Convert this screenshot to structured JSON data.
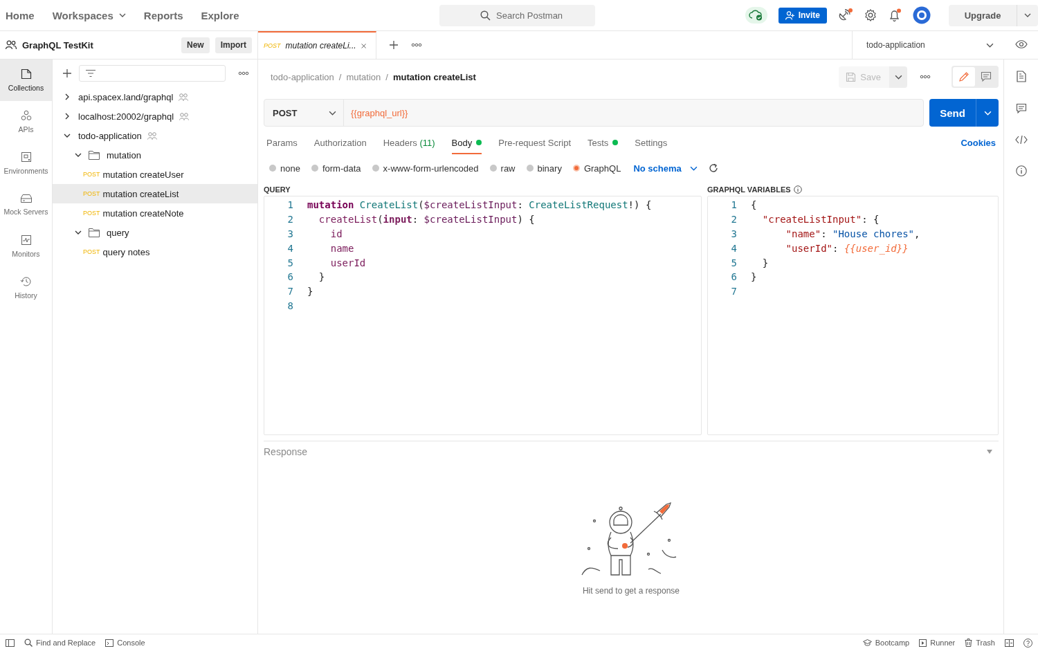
{
  "top_nav": {
    "items": [
      {
        "label": "Home",
        "dropdown": false
      },
      {
        "label": "Workspaces",
        "dropdown": true
      },
      {
        "label": "Reports",
        "dropdown": false
      },
      {
        "label": "Explore",
        "dropdown": false
      }
    ],
    "search": {
      "placeholder": "Search Postman"
    },
    "invite": "Invite",
    "upgrade": "Upgrade"
  },
  "workspace": {
    "name": "GraphQL TestKit",
    "buttons": [
      "New",
      "Import"
    ]
  },
  "left_rail": [
    {
      "label": "Collections",
      "kind": "collections",
      "selected": true
    },
    {
      "label": "APIs",
      "kind": "apis",
      "selected": false
    },
    {
      "label": "Environments",
      "kind": "environments",
      "selected": false
    },
    {
      "label": "Mock Servers",
      "kind": "mock",
      "selected": false
    },
    {
      "label": "Monitors",
      "kind": "monitors",
      "selected": false
    },
    {
      "label": "History",
      "kind": "history",
      "selected": false
    }
  ],
  "tree": [
    {
      "kind": "collection",
      "name": "api.spacex.land/graphql",
      "expanded": false
    },
    {
      "kind": "collection",
      "name": "localhost:20002/graphql",
      "expanded": false
    },
    {
      "kind": "collection",
      "name": "todo-application",
      "expanded": true,
      "children": [
        {
          "kind": "folder",
          "name": "mutation",
          "expanded": true,
          "children": [
            {
              "kind": "request",
              "method": "POST",
              "name": "mutation createUser",
              "selected": false
            },
            {
              "kind": "request",
              "method": "POST",
              "name": "mutation createList",
              "selected": true
            },
            {
              "kind": "request",
              "method": "POST",
              "name": "mutation createNote",
              "selected": false
            }
          ]
        },
        {
          "kind": "folder",
          "name": "query",
          "expanded": true,
          "children": [
            {
              "kind": "request",
              "method": "POST",
              "name": "query notes",
              "selected": false
            }
          ]
        }
      ]
    }
  ],
  "tabs": [
    {
      "method": "POST",
      "title": "mutation createLi...",
      "selected": true
    }
  ],
  "environment": "todo-application",
  "breadcrumb": [
    {
      "label": "todo-application"
    },
    {
      "separator": "/",
      "label": "mutation"
    },
    {
      "separator": "/",
      "label": "mutation createList"
    }
  ],
  "save": "Save",
  "request": {
    "method": "POST",
    "url": "{{graphql_url}}",
    "send": "Send"
  },
  "request_tabs": [
    {
      "label": "Params",
      "dot": false,
      "selected": false
    },
    {
      "label": "Authorization",
      "dot": false,
      "selected": false
    },
    {
      "label": "Headers",
      "count": "(11)",
      "dot": false,
      "selected": false
    },
    {
      "label": "Body",
      "dot": true,
      "selected": true
    },
    {
      "label": "Pre-request Script",
      "dot": false,
      "selected": false
    },
    {
      "label": "Tests",
      "dot": true,
      "selected": false
    },
    {
      "label": "Settings",
      "dot": false,
      "selected": false
    }
  ],
  "cookies": "Cookies",
  "body_types": [
    {
      "label": "none",
      "selected": false
    },
    {
      "label": "form-data",
      "selected": false
    },
    {
      "label": "x-www-form-urlencoded",
      "selected": false
    },
    {
      "label": "raw",
      "selected": false
    },
    {
      "label": "binary",
      "selected": false
    },
    {
      "label": "GraphQL",
      "selected": true
    }
  ],
  "schema": "No schema",
  "query": {
    "title": "QUERY",
    "lines": [
      {
        "n": "1",
        "tokens": [
          {
            "text": "mutation",
            "kind": "keyword"
          },
          {
            "text": " CreateList",
            "kind": "def"
          },
          {
            "text": "(",
            "kind": "punct"
          },
          {
            "text": "$createListInput",
            "kind": "variable"
          },
          {
            "text": ": ",
            "kind": "punct"
          },
          {
            "text": "CreateListRequest",
            "kind": "def"
          },
          {
            "text": "!) {",
            "kind": "punct"
          }
        ]
      },
      {
        "n": "2",
        "tokens": [
          {
            "text": "  createList",
            "kind": "property"
          },
          {
            "text": "(",
            "kind": "punct"
          },
          {
            "text": "input",
            "kind": "attr"
          },
          {
            "text": ": ",
            "kind": "punct"
          },
          {
            "text": "$createListInput",
            "kind": "variable"
          },
          {
            "text": ") {",
            "kind": "punct"
          }
        ]
      },
      {
        "n": "3",
        "tokens": [
          {
            "text": "    id",
            "kind": "property"
          }
        ]
      },
      {
        "n": "4",
        "tokens": [
          {
            "text": "    name",
            "kind": "property"
          }
        ]
      },
      {
        "n": "5",
        "tokens": [
          {
            "text": "    userId",
            "kind": "property"
          }
        ]
      },
      {
        "n": "6",
        "tokens": [
          {
            "text": "  }",
            "kind": "punct"
          }
        ]
      },
      {
        "n": "7",
        "tokens": [
          {
            "text": "}",
            "kind": "punct"
          }
        ]
      },
      {
        "n": "8"
      }
    ]
  },
  "variables": {
    "title": "GRAPHQL VARIABLES",
    "lines": [
      {
        "n": "1",
        "tokens": [
          {
            "text": "{",
            "kind": "punct"
          }
        ]
      },
      {
        "n": "2",
        "tokens": [
          {
            "text": "  \"createListInput\"",
            "kind": "key"
          },
          {
            "text": ": {",
            "kind": "punct"
          }
        ]
      },
      {
        "n": "3",
        "tokens": [
          {
            "text": "      \"name\"",
            "kind": "key"
          },
          {
            "text": ": ",
            "kind": "punct"
          },
          {
            "text": "\"House chores\"",
            "kind": "string"
          },
          {
            "text": ",",
            "kind": "punct"
          }
        ]
      },
      {
        "n": "4",
        "tokens": [
          {
            "text": "      \"userId\"",
            "kind": "key"
          },
          {
            "text": ": ",
            "kind": "punct"
          },
          {
            "text": "{{user_id}}",
            "kind": "template"
          }
        ]
      },
      {
        "n": "5",
        "tokens": [
          {
            "text": "  }",
            "kind": "punct"
          }
        ]
      },
      {
        "n": "6",
        "tokens": [
          {
            "text": "}",
            "kind": "punct"
          }
        ]
      },
      {
        "n": "7"
      }
    ]
  },
  "response": {
    "title": "Response",
    "message": "Hit send to get a response"
  },
  "status_bar": {
    "left": [
      {
        "label": "Find and Replace",
        "kind": "search"
      },
      {
        "label": "Console",
        "kind": "console"
      }
    ],
    "right": [
      {
        "label": "Bootcamp",
        "kind": "bootcamp"
      },
      {
        "label": "Runner",
        "kind": "runner"
      },
      {
        "label": "Trash",
        "kind": "trash"
      }
    ]
  }
}
